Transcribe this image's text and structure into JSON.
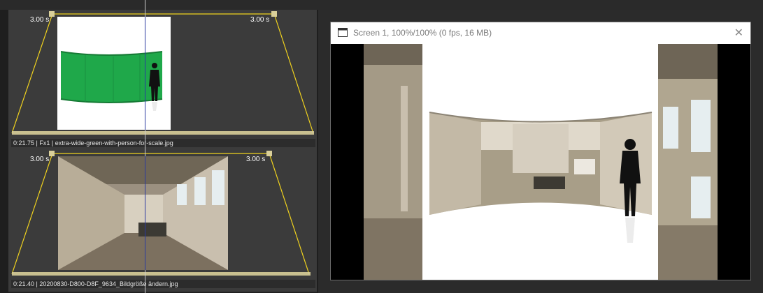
{
  "timeline": {
    "tracks": [
      {
        "label": "0:21.75 | Fx1 | extra-wide-green-with-person-for-scale.jpg",
        "fade_in": "3.00 s",
        "fade_out": "3.00 s",
        "thumbnail_icon": "green-screen-thumbnail"
      },
      {
        "label": "0:21.40 | 20200830-D800-D8F_9634_Bildgröße ändern.jpg",
        "fade_in": "3.00 s",
        "fade_out": "3.00 s",
        "thumbnail_icon": "factory-hall-thumbnail"
      }
    ]
  },
  "screen_window": {
    "title": "Screen 1, 100%/100% (0 fps, 16 MB)",
    "window_icon": "window-icon",
    "close_icon": "close-icon",
    "close_glyph": "✕"
  },
  "colors": {
    "fade_line": "#f0d21e",
    "track_bg": "#3b3b3b",
    "green_screen": "#1fa84a",
    "playhead": "#cfcfcf"
  }
}
